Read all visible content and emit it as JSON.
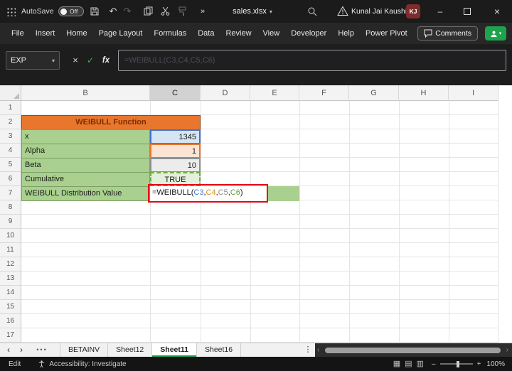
{
  "titlebar": {
    "autosave_label": "AutoSave",
    "autosave_state": "Off",
    "doc_name": "sales.xlsx",
    "user_name": "Kunal Jai Kaushik",
    "user_initials": "KJ"
  },
  "icons": {
    "undo": "↶",
    "redo": "↷",
    "more_commands": "»",
    "dropdown_caret": "▾",
    "window_minimize": "–",
    "window_close": "×",
    "cancel": "×",
    "enter": "✓",
    "fx": "fx",
    "prev_sheet": "‹",
    "next_sheet": "›",
    "sheet_overflow": "•••",
    "sheet_more": "⋮",
    "view_normal": "▦",
    "view_layout": "▤",
    "view_break": "▥",
    "zoom_minus": "–",
    "zoom_plus": "+"
  },
  "ribbon": {
    "tabs": [
      "File",
      "Insert",
      "Home",
      "Page Layout",
      "Formulas",
      "Data",
      "Review",
      "View",
      "Developer",
      "Help",
      "Power Pivot"
    ],
    "comments_label": "Comments"
  },
  "formula_bar": {
    "name_box": "EXP",
    "content": "=WEIBULL(C3,C4,C5,C6)"
  },
  "sheet": {
    "col_letters": [
      "B",
      "C",
      "D",
      "E",
      "F",
      "G",
      "H",
      "I"
    ],
    "row_numbers": [
      "1",
      "2",
      "3",
      "4",
      "5",
      "6",
      "7",
      "8",
      "9",
      "10",
      "11",
      "12",
      "13",
      "14",
      "15",
      "16",
      "17"
    ],
    "title_cell": "WEIBULL Function",
    "labels": [
      "x",
      "Alpha",
      "Beta",
      "Cumulative",
      "WEIBULL Distribution Value"
    ],
    "values": {
      "x": "1345",
      "alpha": "1",
      "beta": "10",
      "cumulative": "TRUE"
    },
    "formula_parts": [
      "=WEIBULL(",
      "C3",
      ",",
      "C4",
      ",",
      "C5",
      ",",
      "C6",
      ")"
    ]
  },
  "tabbar": {
    "sheets": [
      "BETAINV",
      "Sheet12",
      "Sheet11",
      "Sheet16"
    ],
    "active_sheet": "Sheet11"
  },
  "statusbar": {
    "mode": "Edit",
    "accessibility": "Accessibility: Investigate",
    "zoom": "100%"
  },
  "palette": {
    "accent_green": "#1F9D55",
    "title_fill": "#E8762D",
    "label_fill": "#A9D08E",
    "ref1_blue": "#4472C4",
    "ref2_orange": "#E8762D",
    "ref3_gray": "#909090",
    "ref4_green": "#6FAE46",
    "annotation_red": "#E30613"
  }
}
